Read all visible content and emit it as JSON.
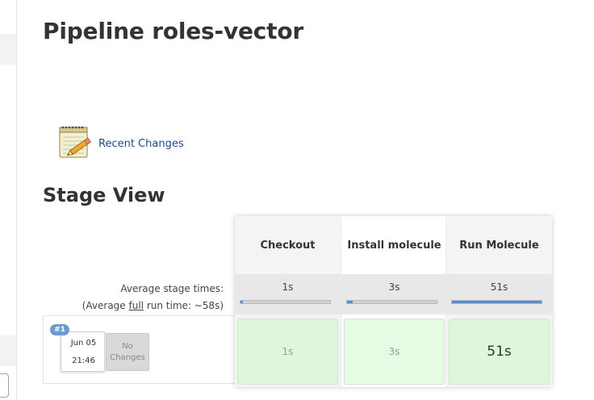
{
  "page": {
    "title": "Pipeline roles-vector"
  },
  "links": {
    "recent_changes": "Recent Changes"
  },
  "stage_view": {
    "title": "Stage View",
    "average_label": "Average stage times:",
    "average_full_prefix": "(Average ",
    "average_full_word": "full",
    "average_full_suffix": " run time: ~58s)",
    "stages": [
      {
        "name": "Checkout",
        "avg_time": "1s",
        "avg_fraction": 0.02
      },
      {
        "name": "Install molecule",
        "avg_time": "3s",
        "avg_fraction": 0.06
      },
      {
        "name": "Run Molecule",
        "avg_time": "51s",
        "avg_fraction": 1.0
      }
    ],
    "runs": [
      {
        "number": "#1",
        "date": "Jun 05",
        "time": "21:46",
        "changes_label_1": "No",
        "changes_label_2": "Changes",
        "stage_times": [
          "1s",
          "3s",
          "51s"
        ]
      }
    ]
  },
  "colors": {
    "success_cell": "#dff5dc",
    "success_cell_light": "#e6fbe4",
    "progress_fill": "#5b8bd0",
    "badge": "#6d9bd1",
    "link": "#204a87"
  },
  "icons": {
    "recent_changes": "notepad-pencil-icon"
  }
}
